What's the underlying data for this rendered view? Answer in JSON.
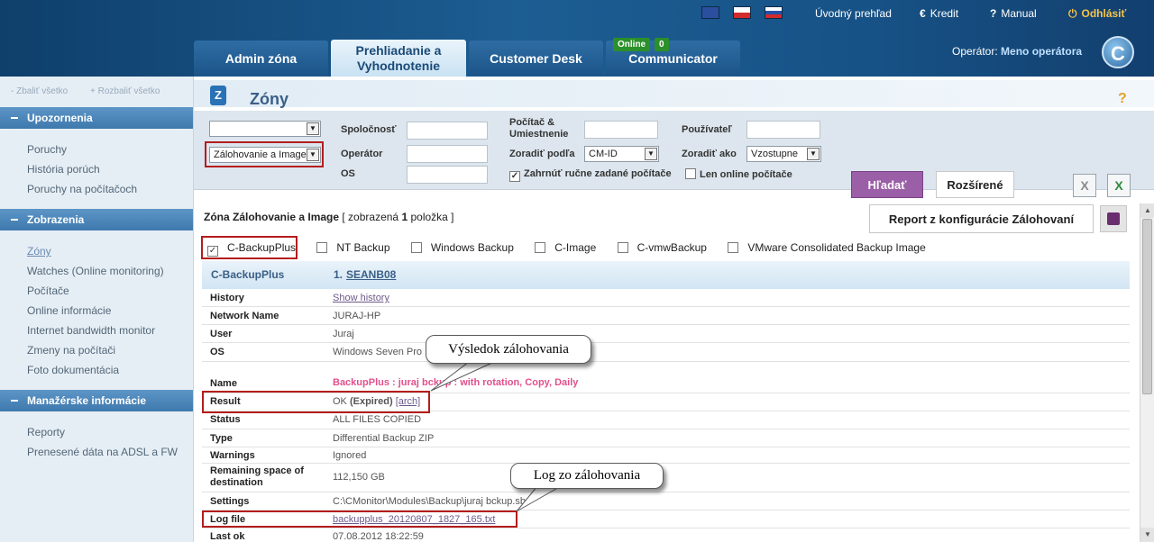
{
  "topbar": {
    "flags": [
      {
        "name": "uk-flag-icon",
        "color": "#2b4f9e"
      },
      {
        "name": "cz-flag-icon",
        "color": "#d32a2a"
      },
      {
        "name": "sk-flag-icon",
        "color": "#2850a8"
      }
    ],
    "home": "Úvodný prehľad",
    "credit_icon": "€",
    "credit": "Kredit",
    "manual_icon": "?",
    "manual": "Manual",
    "logout_icon": "⏻",
    "logout": "Odhlásiť",
    "logout_color": "#f5c44b"
  },
  "tabs": [
    {
      "label": "Admin zóna"
    },
    {
      "label": "Prehliadanie a Vyhodnotenie"
    },
    {
      "label": "Customer Desk"
    },
    {
      "label": "Communicator"
    }
  ],
  "online": {
    "label": "Online",
    "count": "0"
  },
  "operator": {
    "label": "Operátor:",
    "name": "Meno operátora"
  },
  "logo_letter": "C",
  "sidebar": {
    "collapse_all": "- Zbaliť všetko",
    "expand_all": "+ Rozbaliť všetko",
    "sections": [
      {
        "title": "Upozornenia",
        "items": [
          "Poruchy",
          "História porúch",
          "Poruchy na počítačoch"
        ]
      },
      {
        "title": "Zobrazenia",
        "items": [
          "Zóny",
          "Watches (Online monitoring)",
          "Počítače",
          "Online informácie",
          "Internet bandwidth monitor",
          "Zmeny na počítači",
          "Foto dokumentácia"
        ]
      },
      {
        "title": "Manažérske informácie",
        "items": [
          "Reporty",
          "Prenesené dáta na ADSL a FW"
        ]
      }
    ]
  },
  "page": {
    "title": "Zóny",
    "help": "?"
  },
  "filters": {
    "zone_select": "",
    "zone_type_select": "Zálohovanie a Image",
    "company_label": "Spoločnosť",
    "operator_label": "Operátor",
    "os_label": "OS",
    "computer_label": "Počítač & Umiestnenie",
    "user_label": "Používateľ",
    "sort_by_label": "Zoradiť podľa",
    "sort_by_value": "CM-ID",
    "sort_as_label": "Zoradiť ako",
    "sort_as_value": "Vzostupne",
    "include_manual_label": "Zahrnúť ručne zadané počítače",
    "include_manual_checked": true,
    "online_only_label": "Len online počítače",
    "online_only_checked": false,
    "search_button": "Hľadať",
    "advanced_button": "Rozšírené",
    "search_button_color": "#9b5fa8",
    "export_icons": [
      "excel-export-icon",
      "excel-icon"
    ]
  },
  "results": {
    "prefix": "Zóna Zálohovanie a Image",
    "bracket_open": "[ zobrazená",
    "count": "1",
    "bracket_close": "položka ]",
    "report_button": "Report z konfigurácie Zálohovaní",
    "types": [
      {
        "label": "C-BackupPlus",
        "checked": true
      },
      {
        "label": "NT Backup",
        "checked": false
      },
      {
        "label": "Windows Backup",
        "checked": false
      },
      {
        "label": "C-Image",
        "checked": false
      },
      {
        "label": "C-vmwBackup",
        "checked": false
      },
      {
        "label": "VMware Consolidated Backup Image",
        "checked": false
      }
    ]
  },
  "table": {
    "header_type": "C-BackupPlus",
    "header_num": "1.",
    "header_computer": "SEANB08",
    "rows": [
      {
        "key": "History",
        "value": "Show history"
      },
      {
        "key": "Network Name",
        "value": "JURAJ-HP"
      },
      {
        "key": "User",
        "value": "Juraj"
      },
      {
        "key": "OS",
        "value": "Windows Seven Pro"
      },
      {
        "key": "Name",
        "value": "BackupPlus : juraj bckup : with rotation, Copy, Daily"
      },
      {
        "key": "Result",
        "value": "OK",
        "value_extra": "(Expired)",
        "value_link": "[arch]"
      },
      {
        "key": "Status",
        "value": "ALL FILES COPIED"
      },
      {
        "key": "Type",
        "value": "Differential Backup ZIP"
      },
      {
        "key": "Warnings",
        "value": "Ignored"
      },
      {
        "key": "Remaining space of destination",
        "value": "112,150 GB"
      },
      {
        "key": "Settings",
        "value": "C:\\CMonitor\\Modules\\Backup\\juraj bckup.sbs"
      },
      {
        "key": "Log file",
        "value": "backupplus_20120807_1827_165.txt"
      },
      {
        "key": "Last ok",
        "value": "07.08.2012 18:22:59"
      }
    ],
    "name_color": "#e0508c"
  },
  "callouts": [
    {
      "text": "Výsledok zálohovania"
    },
    {
      "text": "Log zo zálohovania"
    }
  ]
}
